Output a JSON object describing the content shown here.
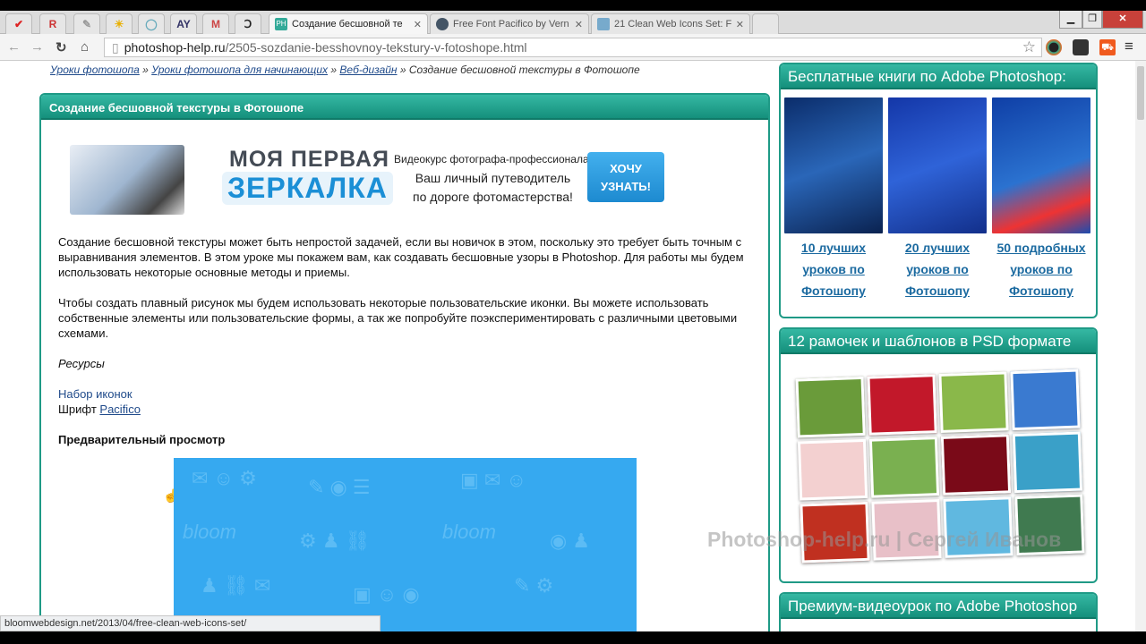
{
  "browser": {
    "pinned_tabs": [
      "✔",
      "R",
      "✎",
      "☀",
      "◯",
      "AY",
      "M",
      "Ↄ"
    ],
    "tabs": [
      {
        "title": "Создание бесшовной те",
        "active": true,
        "favicon": "PH"
      },
      {
        "title": "Free Font Pacifico by Vern",
        "active": false
      },
      {
        "title": "21 Clean Web Icons Set: F",
        "active": false
      }
    ],
    "url_host": "photoshop-help.ru",
    "url_path": "/2505-sozdanie-besshovnoy-tekstury-v-fotoshope.html",
    "status_url": "bloomwebdesign.net/2013/04/free-clean-web-icons-set/"
  },
  "breadcrumbs": [
    "Уроки фотошопа",
    "Уроки фотошопа для начинающих",
    "Веб-дизайн",
    "Создание бесшовной текстуры в Фотошопе"
  ],
  "article": {
    "title": "Создание бесшовной текстуры в Фотошопе",
    "banner": {
      "line1": "МОЯ ПЕРВАЯ",
      "line2": "ЗЕРКАЛКА",
      "desc1": "Видеокурс фотографа-профессионала.",
      "desc2": "Ваш личный путеводитель",
      "desc3": "по дороге фотомастерства!",
      "button1": "ХОЧУ",
      "button2": "УЗНАТЬ!"
    },
    "para1": "Создание бесшовной текстуры  может быть непростой задачей, если вы новичок в этом, поскольку это требует быть точным с выравнивания элементов. В этом уроке мы покажем вам, как создавать бесшовные узоры в Photoshop. Для работы мы будем использовать некоторые основные методы и приемы.",
    "para2": "Чтобы создать плавный рисунок мы будем использовать некоторые пользовательские иконки. Вы можете использовать собственные элементы или пользовательские формы, а так же попробуйте поэкспериментировать с различными цветовыми схемами.",
    "resources_label": "Ресурсы",
    "icons_link": "Набор иконок",
    "font_label": "Шрифт",
    "font_link": "Pacifico",
    "preview_heading": "Предварительный просмотр"
  },
  "sidebar": {
    "books_title": "Бесплатные книги по Adobe Photoshop:",
    "books": [
      {
        "l1": "10 лучших",
        "l2": "уроков по",
        "l3": "Фотошопу"
      },
      {
        "l1": "20 лучших",
        "l2": "уроков по",
        "l3": "Фотошопу"
      },
      {
        "l1": "50 подробных",
        "l2": "уроков по",
        "l3": "Фотошопу"
      }
    ],
    "frames_title": "12 рамочек и шаблонов в PSD формате",
    "premium_title": "Премиум-видеоурок по Adobe Photoshop"
  },
  "watermark": "Photoshop-help.ru | Сергей Иванов",
  "colors": {
    "accent": "#1f9a86",
    "link": "#1f4a8a"
  }
}
